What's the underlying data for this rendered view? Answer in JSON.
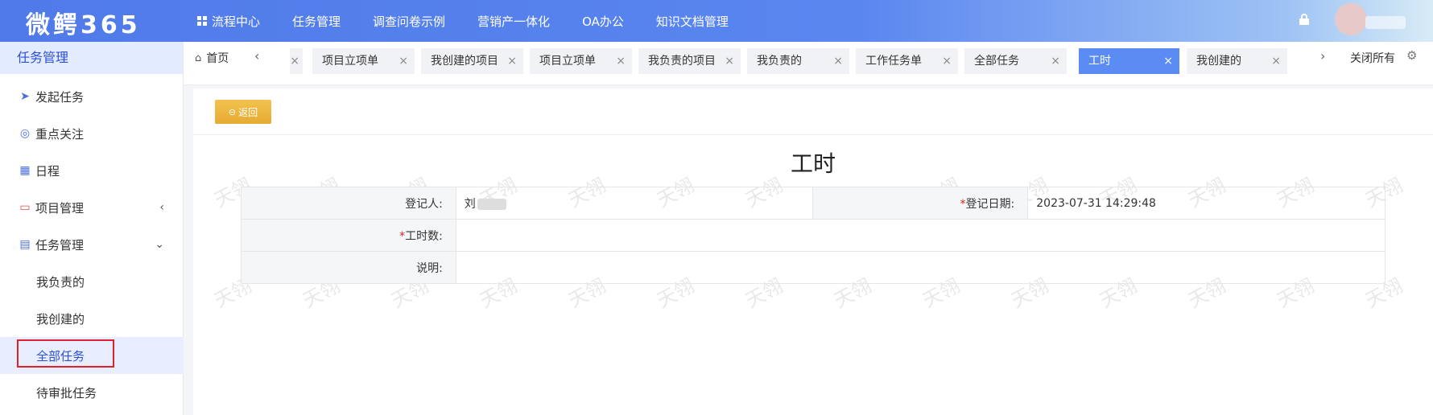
{
  "app": {
    "logo": "微鳄365"
  },
  "topnav": [
    {
      "label": "流程中心",
      "icon": "grid-icon"
    },
    {
      "label": "任务管理"
    },
    {
      "label": "调查问卷示例"
    },
    {
      "label": "营销产一体化"
    },
    {
      "label": "OA办公"
    },
    {
      "label": "知识文档管理"
    }
  ],
  "sidebar": {
    "title": "任务管理",
    "items": [
      {
        "label": "发起任务",
        "icon": "send-icon"
      },
      {
        "label": "重点关注",
        "icon": "target-icon"
      },
      {
        "label": "日程",
        "icon": "calendar-icon"
      },
      {
        "label": "项目管理",
        "icon": "monitor-icon",
        "arrow": "‹"
      },
      {
        "label": "任务管理",
        "icon": "task-icon",
        "arrow": "⌄"
      }
    ],
    "subitems": [
      {
        "label": "我负责的"
      },
      {
        "label": "我创建的"
      },
      {
        "label": "全部任务",
        "active": true
      },
      {
        "label": "待审批任务"
      }
    ]
  },
  "tabs": {
    "home": "首页",
    "items": [
      {
        "label": "项目立项单"
      },
      {
        "label": "我创建的项目"
      },
      {
        "label": "项目立项单"
      },
      {
        "label": "我负责的项目"
      },
      {
        "label": "我负责的"
      },
      {
        "label": "工作任务单"
      },
      {
        "label": "全部任务"
      },
      {
        "label": "工时",
        "active": true
      },
      {
        "label": "我创建的"
      }
    ],
    "close_all": "关闭所有"
  },
  "page": {
    "back_label": "返回",
    "title": "工时",
    "fields": {
      "registrant_label": "登记人:",
      "registrant_value": "刘",
      "date_label": "登记日期:",
      "date_value": "2023-07-31 14:29:48",
      "hours_label": "工时数:",
      "hours_value": "",
      "desc_label": "说明:",
      "desc_value": ""
    },
    "watermark": "天翎"
  },
  "colors": {
    "primary": "#4f7ae8",
    "active_tab": "#5b8cf4",
    "back_button": "#e9b13a",
    "required": "#e02020",
    "highlight_box": "#e0202a"
  }
}
